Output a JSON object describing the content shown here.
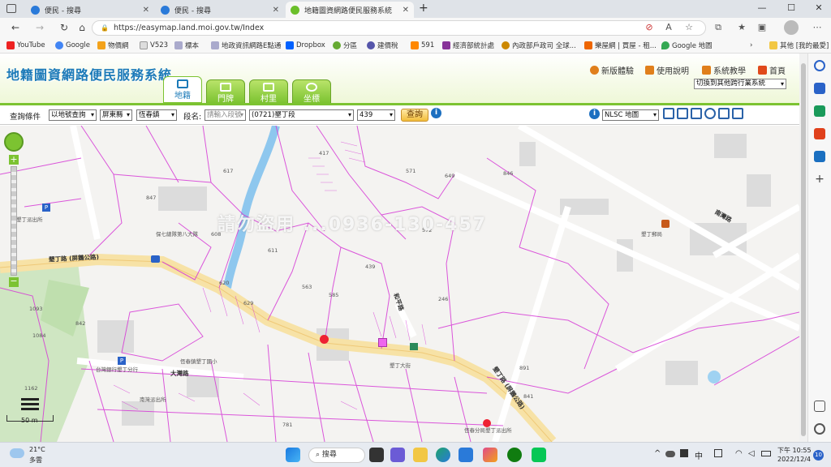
{
  "browser": {
    "tabs": [
      {
        "title": "便民 - 搜尋",
        "active": false
      },
      {
        "title": "便民 - 搜尋",
        "active": false
      },
      {
        "title": "地籍圖資網路便民服務系統",
        "active": true
      }
    ],
    "new_tab": "+",
    "window_controls": {
      "minimize": "—",
      "maximize": "☐",
      "close": "✕"
    },
    "url": "https://easymap.land.moi.gov.tw/Index",
    "bookmarks": [
      "YouTube",
      "Google",
      "物價網",
      "V523",
      "標本",
      "地政資訊網路E點通",
      "Dropbox",
      "分區",
      "建價稅",
      "591",
      "經濟部統計處",
      "內政部戶政司 全球...",
      "樂屋網 | 買屋 - 租...",
      "Google 地圖"
    ],
    "other_bookmarks": "其他 [我的最愛]"
  },
  "app": {
    "logo": "地籍圖資網路便民服務系統",
    "tabs": [
      {
        "label": "地籍",
        "active": true
      },
      {
        "label": "門牌",
        "active": false
      },
      {
        "label": "村里",
        "active": false
      },
      {
        "label": "坐標",
        "active": false
      }
    ],
    "links": [
      "新版體驗",
      "使用說明",
      "系統教學",
      "首頁"
    ],
    "other_system": "切換到其他跨行業系統"
  },
  "query": {
    "label": "查詢條件",
    "mode": "以地號查詢",
    "county": "屏東縣",
    "town": "恆春鎮",
    "section_label": "段名:",
    "section_placeholder": "請輸入段號",
    "section": "(0721)墾丁段",
    "number": "439",
    "button": "查詢",
    "basemap": "NLSC 地圖"
  },
  "map": {
    "watermark": "請勿盜用 ...0936-130-457",
    "scale": "50 m",
    "labels": [
      "墾丁路 (屏鵝公路)",
      "墾丁路 (屏鵝公路)",
      "和平路",
      "大灣路",
      "南灣路",
      "墾丁派出所",
      "保七總隊第八大隊",
      "台灣銀行墾丁分行",
      "墾丁大街",
      "恆春鎮墾丁國小",
      "墾丁郵局",
      "南灣派出所",
      "恆春分局墾丁派出所"
    ],
    "lot_numbers": [
      "417",
      "846",
      "617",
      "649",
      "572",
      "439",
      "847",
      "620",
      "629",
      "842",
      "891",
      "1093",
      "1084",
      "1162",
      "841",
      "781",
      "563",
      "585",
      "246",
      "571",
      "608",
      "611"
    ]
  },
  "taskbar": {
    "weather_temp": "21°C",
    "weather_desc": "多雲",
    "search": "搜尋",
    "ime": "中",
    "time": "下午 10:55",
    "date": "2022/12/4",
    "notifications": "10"
  }
}
